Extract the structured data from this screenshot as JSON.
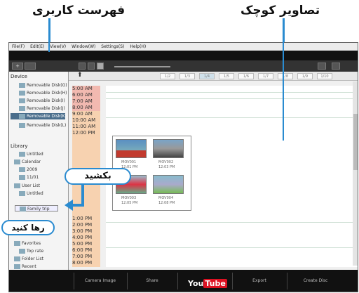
{
  "callouts": {
    "user_list": "فهرست کاربری",
    "thumbnails": "تصاویر کوچک",
    "drag": "بکشید",
    "drop": "رها کنید"
  },
  "menu": [
    "File(F)",
    "Edit(E)",
    "View(V)",
    "Window(W)",
    "Settings(S)",
    "Help(H)"
  ],
  "toolbar": {
    "home": "+",
    "back": "⮌",
    "arrow": "⬆"
  },
  "sidebar": {
    "device_title": "Device",
    "devices": [
      "Removable Disk(G)",
      "Removable Disk(H)",
      "Removable Disk(I)",
      "Removable Disk(J)",
      "Removable Disk(K)",
      "Removable Disk(L)"
    ],
    "library_title": "Library",
    "library": [
      "Untitled",
      "Calendar",
      "2009",
      "11/01",
      "User List",
      "Untitled",
      "Family trip",
      "Favorites",
      "Top rate",
      "Folder List",
      "Recent"
    ]
  },
  "dates": [
    "1/2",
    "1/3",
    "1/4",
    "1/5",
    "1/6",
    "1/7",
    "1/8",
    "1/9",
    "1/10"
  ],
  "times_am": [
    "5:00 AM",
    "6:00 AM",
    "7:00 AM",
    "8:00 AM",
    "9:00 AM",
    "10:00 AM",
    "11:00 AM",
    "12:00 PM"
  ],
  "times_pm": [
    "1:00 PM",
    "2:00 PM",
    "3:00 PM",
    "4:00 PM",
    "5:00 PM",
    "6:00 PM",
    "7:00 PM",
    "8:00 PM"
  ],
  "thumbs": [
    {
      "name": "MOV001",
      "time": "12:01 PM",
      "colors": [
        "#5a8fc2",
        "#c23a2e"
      ]
    },
    {
      "name": "MOV002",
      "time": "12:03 PM",
      "colors": [
        "#7aa4c8",
        "#444"
      ]
    },
    {
      "name": "MOV003",
      "time": "12:05 PM",
      "colors": [
        "#d34",
        "#6a8"
      ]
    },
    {
      "name": "MOV004",
      "time": "12:08 PM",
      "colors": [
        "#8bc",
        "#7b5"
      ]
    }
  ],
  "bottom": [
    "Camera Image",
    "Share",
    "YouTube",
    "Export",
    "Create Disc"
  ]
}
